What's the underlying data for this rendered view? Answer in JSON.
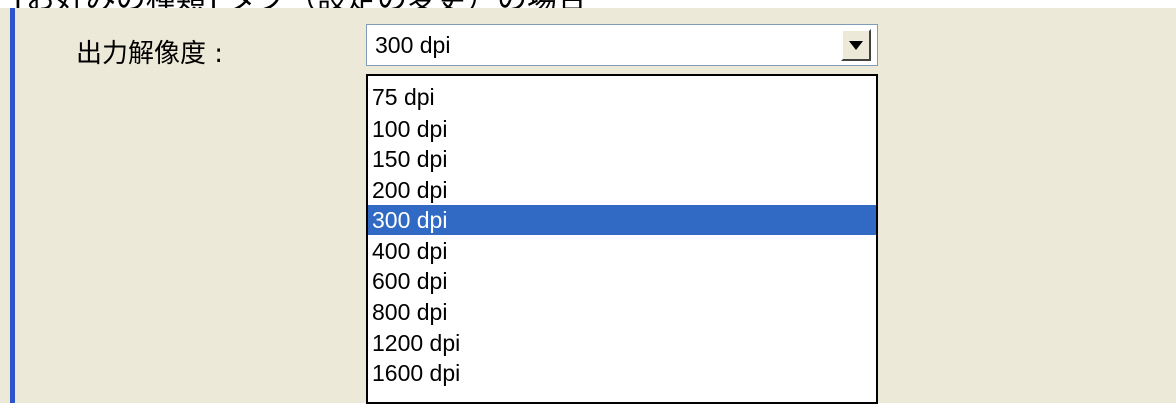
{
  "header": {
    "clipped_title": "[お好みの種類] タブ（設定の変更）の場合"
  },
  "form": {
    "resolution_label": "出力解像度 :",
    "resolution_value": "300 dpi",
    "resolution_options": [
      "75 dpi",
      "100 dpi",
      "150 dpi",
      "200 dpi",
      "300 dpi",
      "400 dpi",
      "600 dpi",
      "800 dpi",
      "1200 dpi",
      "1600 dpi"
    ],
    "selected_index": 4
  },
  "icons": {
    "dropdown_arrow": "chevron-down-icon"
  },
  "colors": {
    "panel_bg": "#ece9d8",
    "selection": "#316ac5",
    "left_border": "#2f55c8"
  }
}
